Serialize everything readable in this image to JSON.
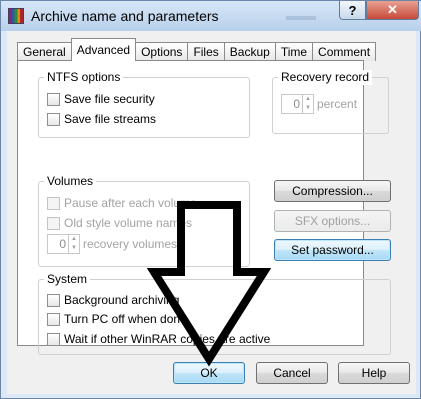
{
  "window": {
    "title": "Archive name and parameters",
    "help_button": "?",
    "close_button": "✕"
  },
  "tabs": [
    {
      "label": "General"
    },
    {
      "label": "Advanced",
      "active": true
    },
    {
      "label": "Options"
    },
    {
      "label": "Files"
    },
    {
      "label": "Backup"
    },
    {
      "label": "Time"
    },
    {
      "label": "Comment"
    }
  ],
  "ntfs": {
    "title": "NTFS options",
    "save_security": "Save file security",
    "save_streams": "Save file streams"
  },
  "recovery_record": {
    "title": "Recovery record",
    "value": "0",
    "unit": "percent"
  },
  "volumes": {
    "title": "Volumes",
    "pause": "Pause after each volume",
    "old_style": "Old style volume names",
    "recovery_value": "0",
    "recovery_label": "recovery volumes"
  },
  "buttons": {
    "compression": "Compression...",
    "sfx_options": "SFX options...",
    "set_password": "Set password...",
    "ok": "OK",
    "cancel": "Cancel",
    "help": "Help"
  },
  "system": {
    "title": "System",
    "background": "Background archiving",
    "turn_off": "Turn PC off when done",
    "wait": "Wait if other WinRAR copies are active"
  },
  "annotation": {
    "type": "down-arrow",
    "color": "#000000"
  }
}
